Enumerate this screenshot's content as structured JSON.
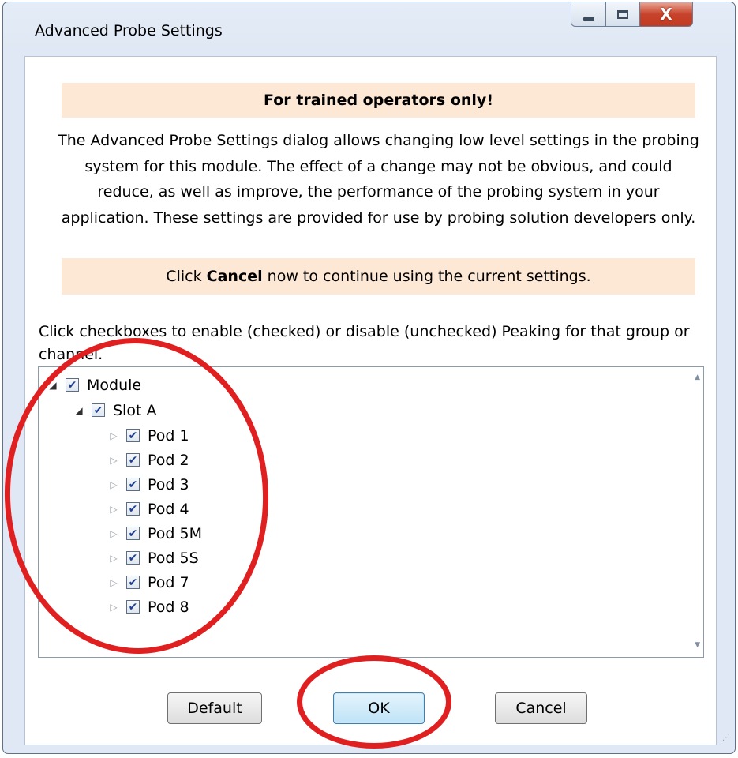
{
  "window": {
    "title": "Advanced Probe Settings",
    "controls": {
      "minimize": "minimize",
      "maximize": "maximize",
      "close_glyph": "X"
    }
  },
  "warning_banner": "For trained operators only!",
  "description": "The Advanced Probe Settings dialog allows changing low level settings in the probing system for this module. The effect of a change may not be obvious, and could reduce, as well as improve, the performance of the probing system in your application. These settings are provided for use by probing solution developers only.",
  "cancel_banner": {
    "prefix": "Click",
    "bold": "Cancel",
    "suffix": "now to continue using the current settings."
  },
  "instruction": "Click checkboxes to enable (checked) or disable (unchecked) Peaking for that group or channel.",
  "tree": {
    "root": {
      "label": "Module",
      "checked": true,
      "expanded": true
    },
    "slot": {
      "label": "Slot A",
      "checked": true,
      "expanded": true
    },
    "pods": [
      {
        "label": "Pod 1",
        "checked": true
      },
      {
        "label": "Pod 2",
        "checked": true
      },
      {
        "label": "Pod 3",
        "checked": true
      },
      {
        "label": "Pod 4",
        "checked": true
      },
      {
        "label": "Pod 5M",
        "checked": true
      },
      {
        "label": "Pod 5S",
        "checked": true
      },
      {
        "label": "Pod 7",
        "checked": true
      },
      {
        "label": "Pod 8",
        "checked": true
      }
    ]
  },
  "buttons": {
    "default": "Default",
    "ok": "OK",
    "cancel": "Cancel"
  },
  "annotation_color": "#e02020"
}
